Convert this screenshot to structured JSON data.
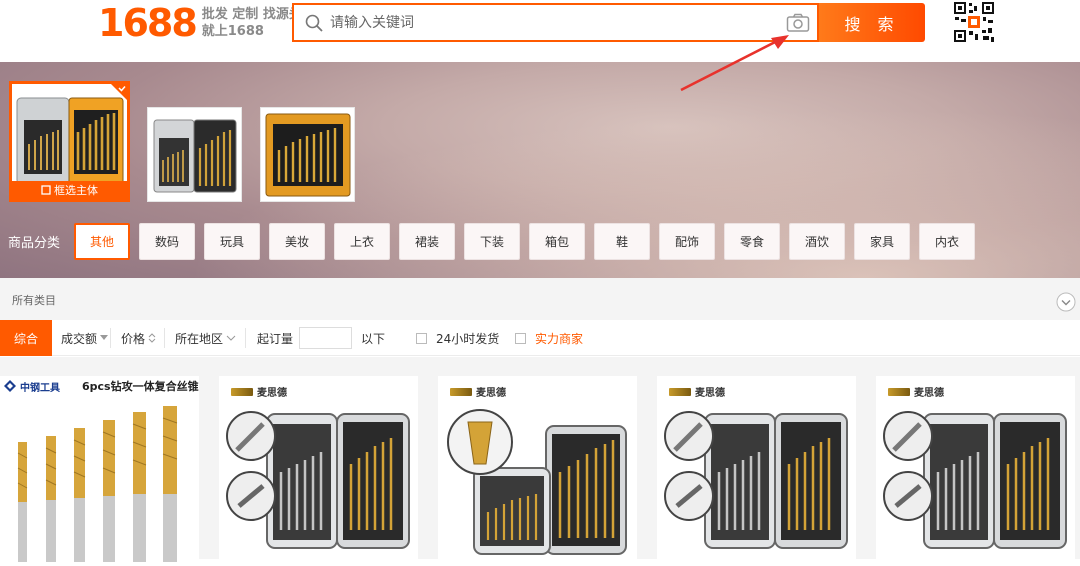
{
  "header": {
    "logo_number": "1688",
    "slogan_line1": "批发 定制 找源头",
    "slogan_line2": "就上1688",
    "search_placeholder": "请输入关键词",
    "search_button": "搜 索"
  },
  "image_search": {
    "thumbnails": [
      {
        "selected": true,
        "badge": "框选主体"
      },
      {
        "selected": false
      },
      {
        "selected": false
      }
    ]
  },
  "categories": {
    "label": "商品分类",
    "items": [
      "其他",
      "数码",
      "玩具",
      "美妆",
      "上衣",
      "裙装",
      "下装",
      "箱包",
      "鞋",
      "配饰",
      "零食",
      "酒饮",
      "家具",
      "内衣"
    ],
    "active_index": 0
  },
  "all_categories_label": "所有类目",
  "sort": {
    "default": "综合",
    "volume": "成交额",
    "price": "价格",
    "location": "所在地区",
    "moq_label": "起订量",
    "moq_suffix": "以下",
    "ship24": "24小时发货",
    "factory": "实力商家"
  },
  "products": [
    {
      "brand": "中钢工具",
      "title": "6pcs钻攻一体复合丝锥"
    },
    {
      "brand": "麦思德"
    },
    {
      "brand": "麦思德"
    },
    {
      "brand": "麦思德"
    },
    {
      "brand": "麦思德"
    }
  ],
  "colors": {
    "accent": "#ff5a00",
    "annotation_arrow": "#e8322c"
  },
  "icons": [
    "search-icon",
    "camera-icon",
    "qr-code-icon",
    "expand-icon",
    "crop-icon",
    "check-corner-icon"
  ]
}
